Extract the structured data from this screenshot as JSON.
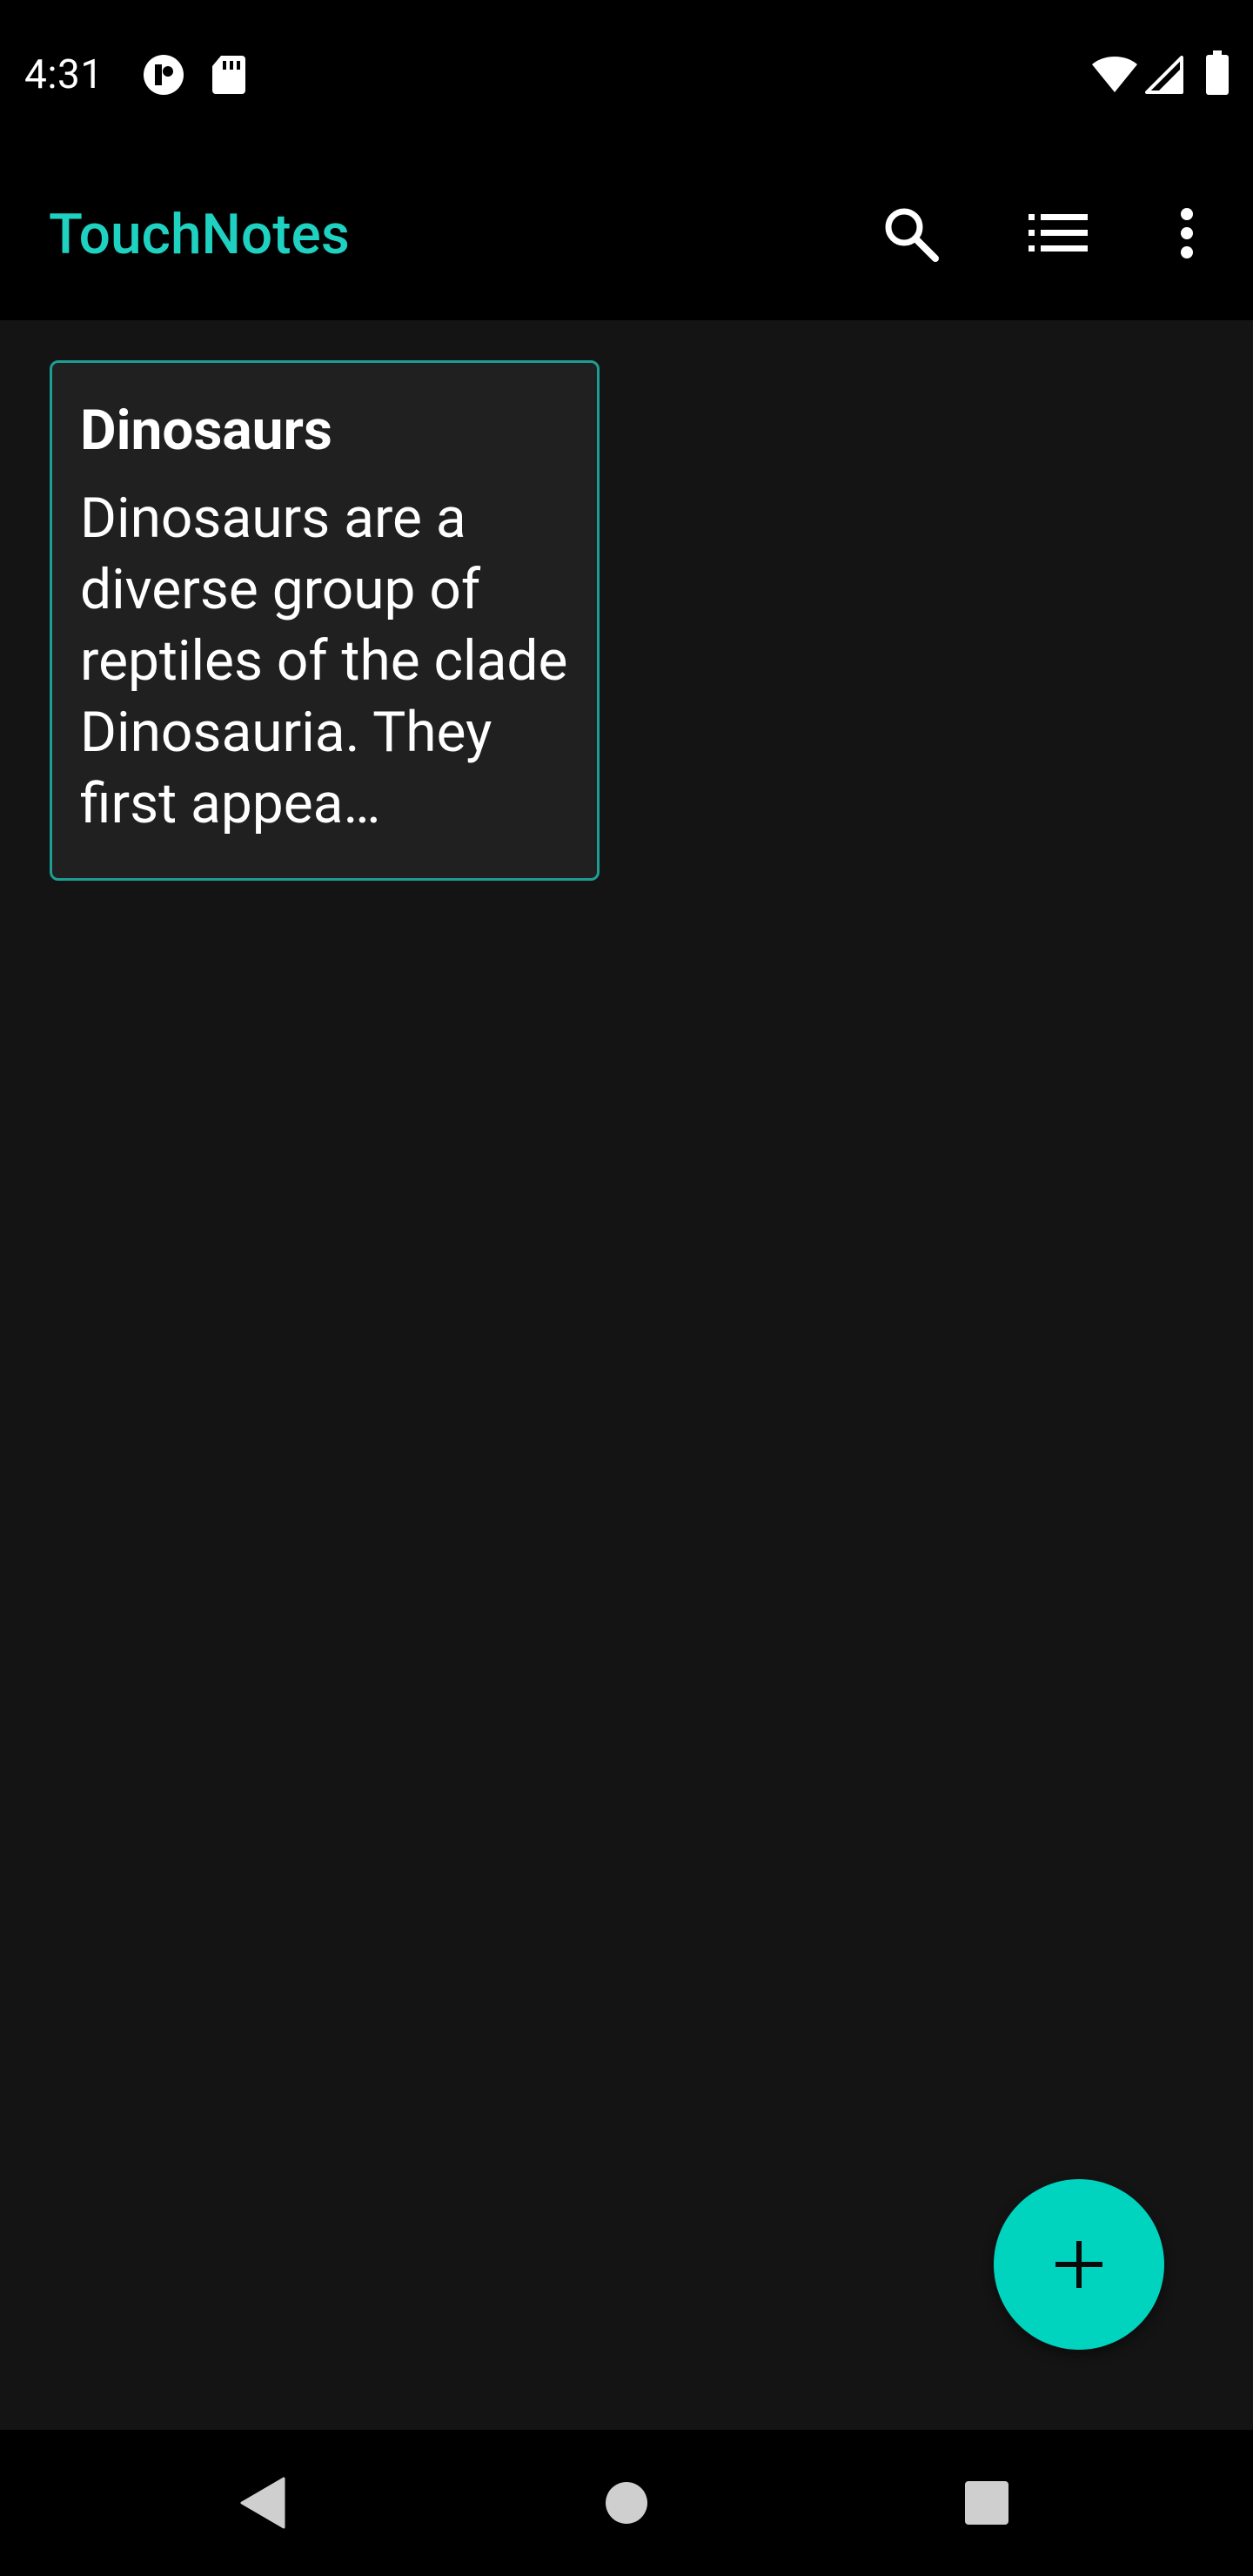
{
  "status_bar": {
    "time": "4:31",
    "icons": [
      "notification-app-icon",
      "sd-card-icon",
      "wifi-icon",
      "cell-signal-icon",
      "battery-icon"
    ]
  },
  "app_bar": {
    "title": "TouchNotes",
    "actions": [
      "search-icon",
      "view-list-icon",
      "more-vert-icon"
    ]
  },
  "notes": [
    {
      "title": "Dinosaurs",
      "preview": "Dinosaurs are a diverse group of reptiles of the clade Dinosauria. They first appea…",
      "border_color": "#1d9e94"
    }
  ],
  "fab": {
    "icon": "plus-icon",
    "color": "#00d4bf"
  },
  "nav_bar": {
    "icons": [
      "back-icon",
      "home-icon",
      "recents-icon"
    ]
  },
  "colors": {
    "accent": "#1fd1c0",
    "background": "#141414",
    "card": "#202020",
    "bars": "#000000"
  }
}
